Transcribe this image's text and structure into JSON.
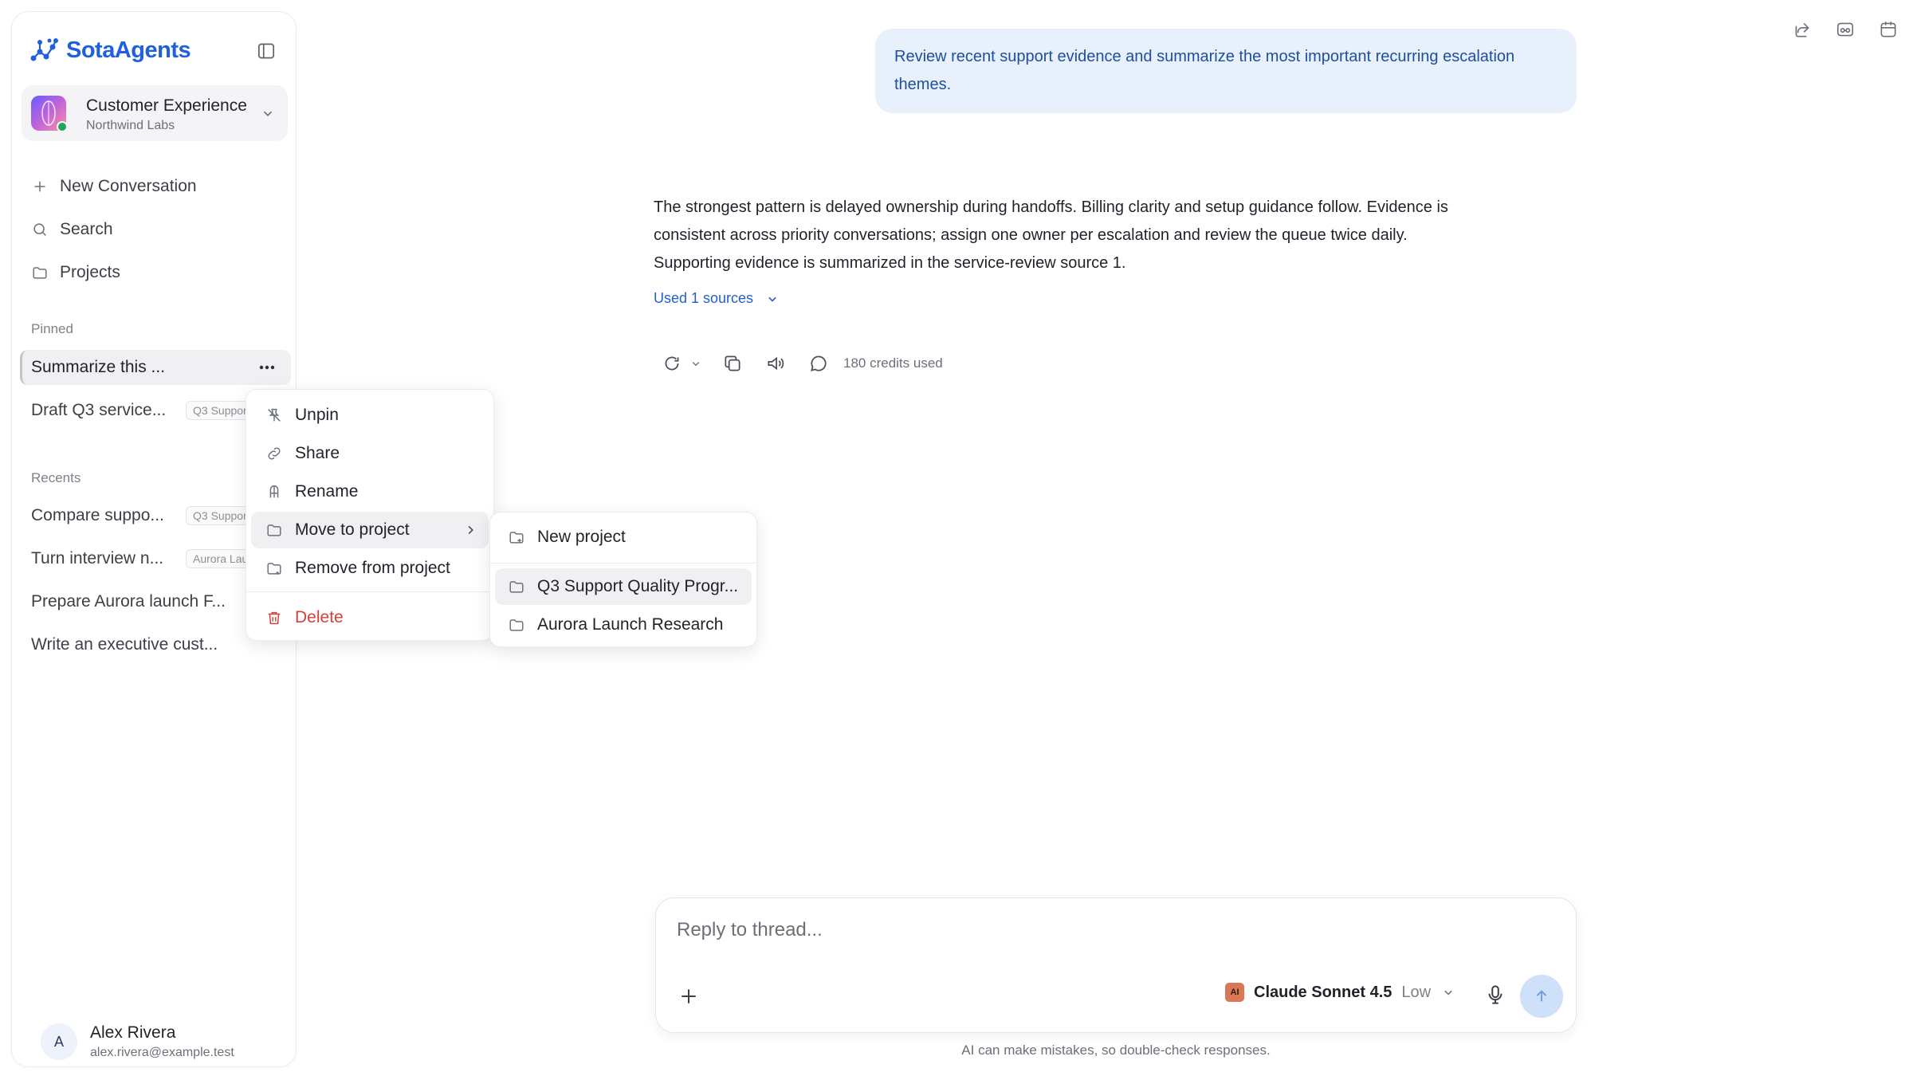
{
  "brand": {
    "name": "SotaAgents"
  },
  "workspace": {
    "name": "Customer Experience",
    "org": "Northwind Labs"
  },
  "nav": {
    "new_conversation": "New Conversation",
    "search": "Search",
    "projects": "Projects"
  },
  "sections": {
    "pinned": "Pinned",
    "recents": "Recents"
  },
  "pinned": [
    {
      "title": "Summarize this ...",
      "tag": ""
    },
    {
      "title": "Draft Q3 service...",
      "tag": "Q3 Support"
    }
  ],
  "recents": [
    {
      "title": "Compare suppo...",
      "tag": "Q3 Support"
    },
    {
      "title": "Turn interview n...",
      "tag": "Aurora Lau"
    },
    {
      "title": "Prepare Aurora launch F...",
      "tag": ""
    },
    {
      "title": "Write an executive cust...",
      "tag": ""
    }
  ],
  "user": {
    "initial": "A",
    "name": "Alex Rivera",
    "email": "alex.rivera@example.test"
  },
  "thread": {
    "user_message": "Review recent support evidence and summarize the most important recurring escalation themes.",
    "answer_line1": "The strongest pattern is delayed ownership during handoffs. Billing clarity and setup guidance follow. Evidence is",
    "answer_line2": "consistent across priority conversations; assign one owner per escalation and review the queue twice daily.",
    "answer_line3": "Supporting evidence is summarized in the service-review source 1.",
    "sources_label": "Used 1 sources",
    "credits": "180 credits used"
  },
  "context_menu": {
    "unpin": "Unpin",
    "share": "Share",
    "rename": "Rename",
    "move_to_project": "Move to project",
    "remove_from_project": "Remove from project",
    "delete": "Delete"
  },
  "submenu": {
    "new_project": "New project",
    "projects": [
      "Q3 Support Quality Progr...",
      "Aurora Launch Research"
    ]
  },
  "composer": {
    "placeholder": "Reply to thread...",
    "model_badge": "AI",
    "model": "Claude Sonnet 4.5",
    "effort": "Low"
  },
  "disclaimer": "AI can make mistakes, so double-check responses.",
  "colors": {
    "brand": "#1f5fe0",
    "danger": "#d0423a",
    "bubble": "#e8f0fc",
    "send": "#cfe0fb",
    "status_online": "#22a35a"
  }
}
